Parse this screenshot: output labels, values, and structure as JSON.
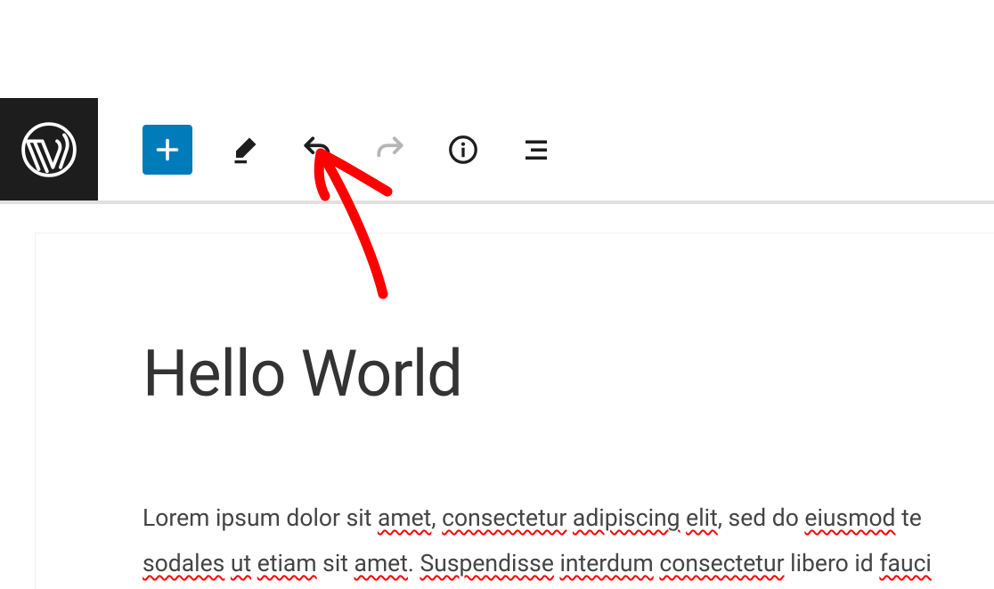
{
  "toolbar": {
    "wp_logo": "wordpress",
    "add_label": "Add block",
    "edit_label": "Tools",
    "undo_label": "Undo",
    "redo_label": "Redo",
    "info_label": "Details",
    "outline_label": "Outline"
  },
  "post": {
    "title": "Hello World",
    "body_plain_1": "Lorem ipsum dolor sit ",
    "w_amet1": "amet",
    "body_plain_2": ", ",
    "w_consectetur": "consectetur",
    "sp1": " ",
    "w_adipiscing": "adipiscing",
    "sp2": " ",
    "w_elit": "elit",
    "body_plain_3": ", sed do ",
    "w_eiusmod": "eiusmod",
    "body_plain_4": " te",
    "w_sodales": "sodales",
    "sp3": " ",
    "w_ut": "ut",
    "sp4": " ",
    "w_etiam": "etiam",
    "body_plain_5": " sit ",
    "w_amet2": "amet",
    "body_plain_6": ". ",
    "w_suspendisse": "Suspendisse",
    "sp5": " ",
    "w_interdum": "interdum",
    "sp6": " ",
    "w_consectetur2": "consectetur",
    "body_plain_7": " libero id ",
    "w_fauci": "fauci"
  },
  "colors": {
    "accent": "#007cba",
    "annotation": "#ff0000"
  }
}
